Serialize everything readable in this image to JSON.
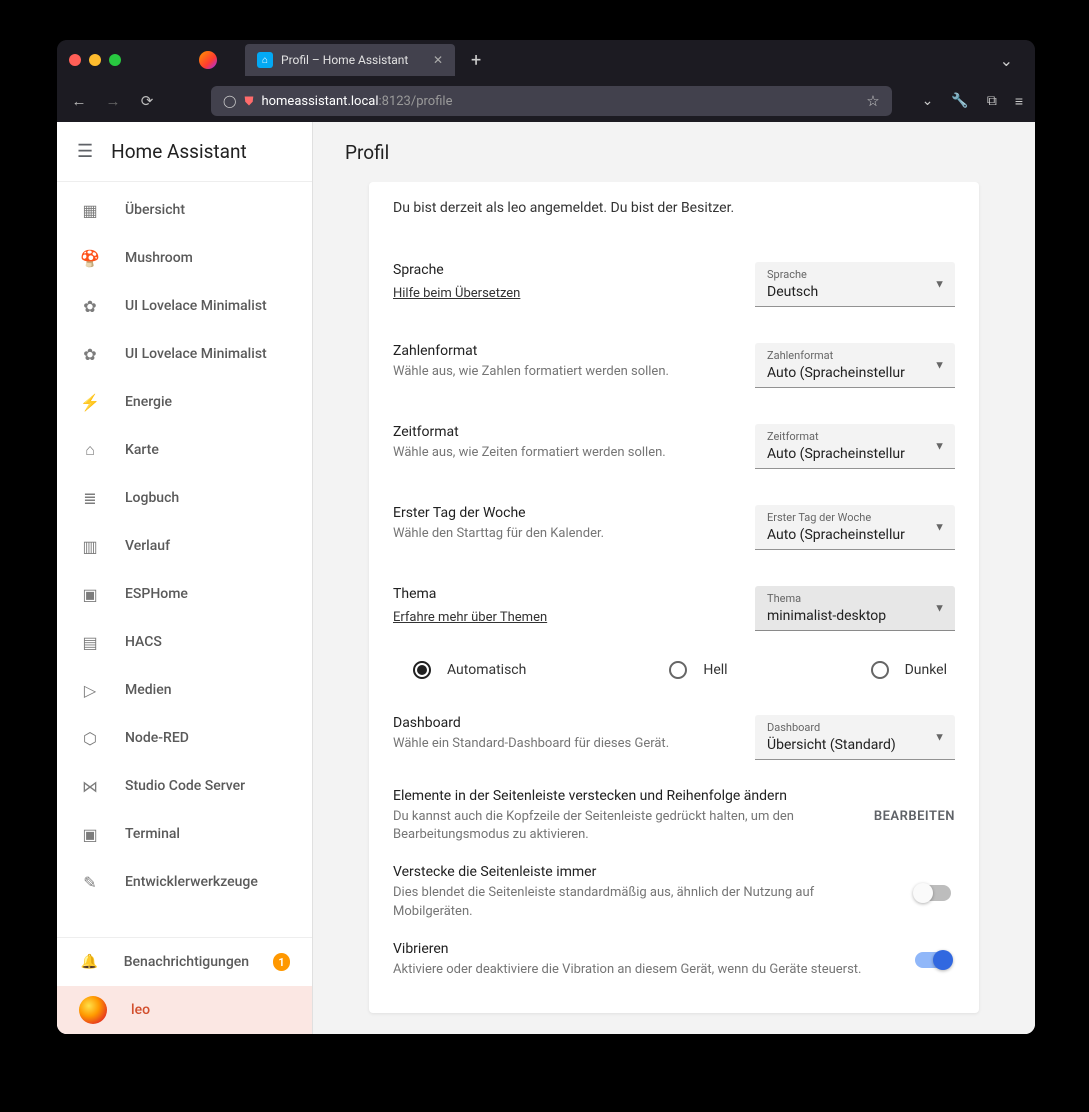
{
  "browser": {
    "tab_title": "Profil – Home Assistant",
    "url_host": "homeassistant.local",
    "url_port_path": ":8123/profile"
  },
  "sidebar": {
    "title": "Home Assistant",
    "items": [
      {
        "icon": "▦",
        "label": "Übersicht"
      },
      {
        "icon": "🍄",
        "label": "Mushroom"
      },
      {
        "icon": "✿",
        "label": "UI Lovelace Minimalist"
      },
      {
        "icon": "✿",
        "label": "UI Lovelace Minimalist"
      },
      {
        "icon": "⚡",
        "label": "Energie"
      },
      {
        "icon": "⌂",
        "label": "Karte"
      },
      {
        "icon": "≣",
        "label": "Logbuch"
      },
      {
        "icon": "▥",
        "label": "Verlauf"
      },
      {
        "icon": "▣",
        "label": "ESPHome"
      },
      {
        "icon": "▤",
        "label": "HACS"
      },
      {
        "icon": "▷",
        "label": "Medien"
      },
      {
        "icon": "⬡",
        "label": "Node-RED"
      },
      {
        "icon": "⋈",
        "label": "Studio Code Server"
      },
      {
        "icon": "▣",
        "label": "Terminal"
      },
      {
        "icon": "✎",
        "label": "Entwicklerwerkzeuge"
      }
    ],
    "notifications": {
      "label": "Benachrichtigungen",
      "count": "1"
    },
    "user": {
      "label": "leo"
    }
  },
  "main": {
    "title": "Profil",
    "intro": "Du bist derzeit als leo angemeldet. Du bist der Besitzer.",
    "language": {
      "title": "Sprache",
      "link": "Hilfe beim Übersetzen",
      "select_label": "Sprache",
      "select_value": "Deutsch"
    },
    "number_format": {
      "title": "Zahlenformat",
      "desc": "Wähle aus, wie Zahlen formatiert werden sollen.",
      "select_label": "Zahlenformat",
      "select_value": "Auto (Spracheinstellur"
    },
    "time_format": {
      "title": "Zeitformat",
      "desc": "Wähle aus, wie Zeiten formatiert werden sollen.",
      "select_label": "Zeitformat",
      "select_value": "Auto (Spracheinstellur"
    },
    "first_day": {
      "title": "Erster Tag der Woche",
      "desc": "Wähle den Starttag für den Kalender.",
      "select_label": "Erster Tag der Woche",
      "select_value": "Auto (Spracheinstellur"
    },
    "theme": {
      "title": "Thema",
      "link": "Erfahre mehr über Themen",
      "select_label": "Thema",
      "select_value": "minimalist-desktop",
      "radios": {
        "auto": "Automatisch",
        "light": "Hell",
        "dark": "Dunkel"
      }
    },
    "dashboard": {
      "title": "Dashboard",
      "desc": "Wähle ein Standard-Dashboard für dieses Gerät.",
      "select_label": "Dashboard",
      "select_value": "Übersicht (Standard)"
    },
    "sidebar_edit": {
      "title": "Elemente in der Seitenleiste verstecken und Reihenfolge ändern",
      "desc": "Du kannst auch die Kopfzeile der Seitenleiste gedrückt halten, um den Bearbeitungsmodus zu aktivieren.",
      "button": "BEARBEITEN"
    },
    "hide_sidebar": {
      "title": "Verstecke die Seitenleiste immer",
      "desc": "Dies blendet die Seitenleiste standardmäßig aus, ähnlich der Nutzung auf Mobilgeräten."
    },
    "vibrate": {
      "title": "Vibrieren",
      "desc": "Aktiviere oder deaktiviere die Vibration an diesem Gerät, wenn du Geräte steuerst."
    }
  }
}
